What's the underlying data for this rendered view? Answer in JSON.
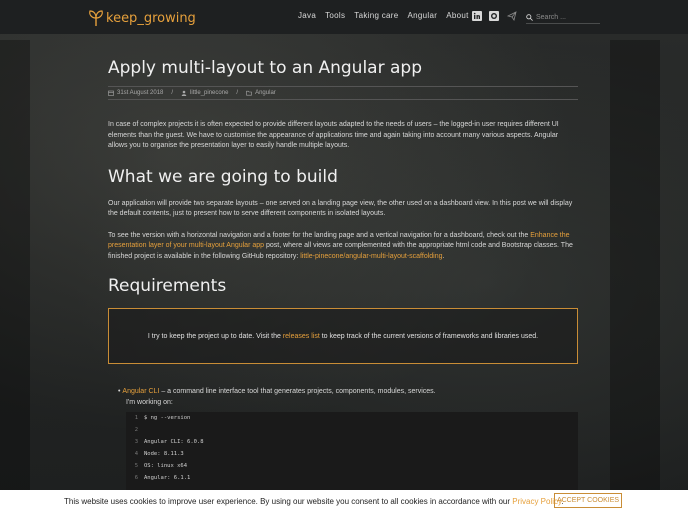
{
  "brand": {
    "name": "keep_growing",
    "accent": "#e6a03c"
  },
  "nav": {
    "items": [
      "Java",
      "Tools",
      "Taking care",
      "Angular",
      "About"
    ],
    "search_placeholder": "Search ..."
  },
  "article": {
    "title": "Apply multi-layout to an Angular app",
    "date": "31st August 2018",
    "author": "little_pinecone",
    "category": "Angular",
    "intro": "In case of complex projects it is often expected to provide different layouts adapted to the needs of users – the logged-in user requires different UI elements than the guest. We have to customise the appearance of applications time and again taking into account many various aspects. Angular allows you to organise the presentation layer to easily handle multiple layouts.",
    "h2_build": "What we are going to build",
    "p_build": "Our application will provide two separate layouts – one served on a landing page view, the other used on a dashboard view. In this post we will display the default contents, just to present how to serve different components in isolated layouts.",
    "p_version_a": "To see the version with a horizontal navigation and a footer for the landing page and a vertical navigation for a dashboard, check out the ",
    "p_version_link": "Enhance the presentation layer of your multi-layout Angular app",
    "p_version_b": " post, where all views are complemented with the appropriate html code and Bootstrap classes. The finished project is available in the following GitHub repository: ",
    "p_version_repo": "little-pinecone/angular-multi-layout-scaffolding",
    "p_version_end": ".",
    "h2_req": "Requirements",
    "notice_a": "I try to keep the project up to date. Visit the ",
    "notice_link": "releases list",
    "notice_b": " to keep track of the current versions of frameworks and libraries used.",
    "req_link": "Angular CLI",
    "req_text": " – a command line interface tool that generates projects, components, modules, services.",
    "req_working": "I'm working on:",
    "code": [
      {
        "n": "1",
        "t": "$ ng --version"
      },
      {
        "n": "2",
        "t": ""
      },
      {
        "n": "3",
        "t": "Angular CLI: 6.0.8"
      },
      {
        "n": "4",
        "t": "Node: 8.11.3"
      },
      {
        "n": "5",
        "t": "OS: linux x64"
      },
      {
        "n": "6",
        "t": "Angular: 6.1.1"
      }
    ]
  },
  "cookie": {
    "text": "This website uses cookies to improve user experience. By using our website you consent to all cookies in accordance with our ",
    "link": "Privacy Policy",
    "end": ".",
    "button": "ACCEPT COOKIES"
  }
}
